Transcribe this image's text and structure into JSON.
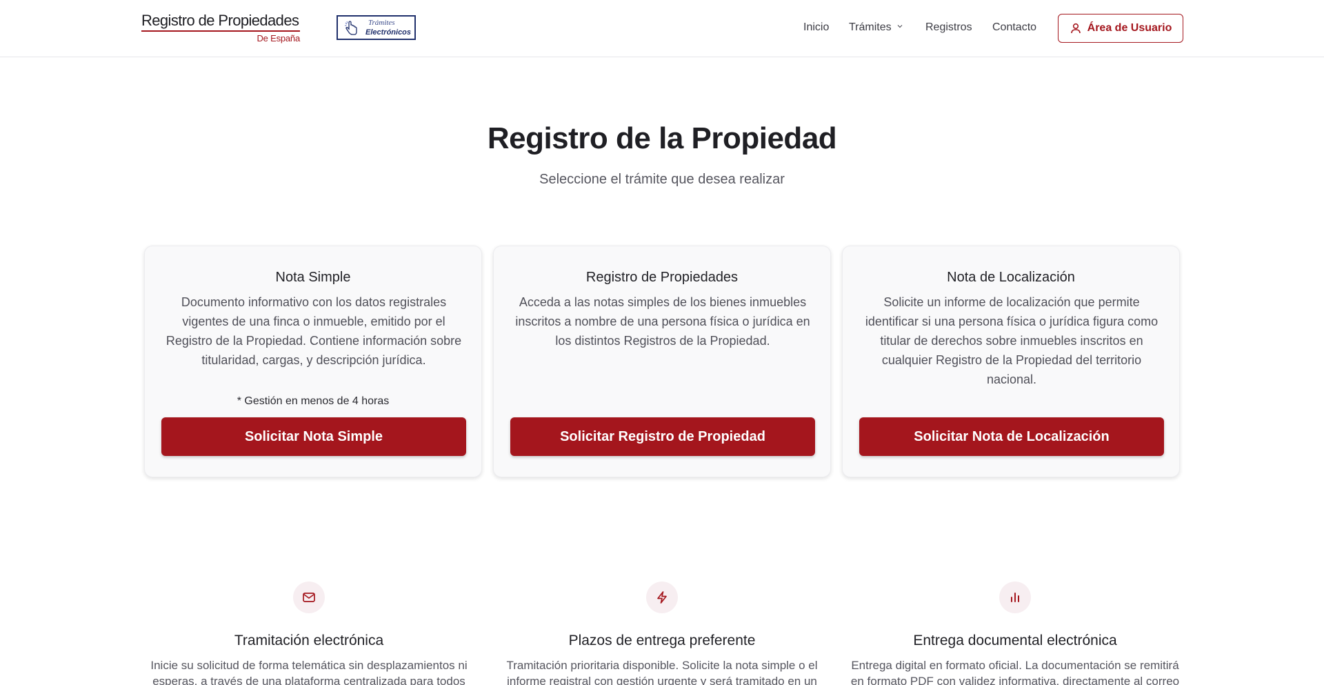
{
  "header": {
    "logo_main": "Registro de Propiedades",
    "logo_sub": "De España",
    "tramites_line1": "Trámites",
    "tramites_line2": "Electrónicos",
    "nav": {
      "inicio": "Inicio",
      "tramites": "Trámites",
      "registros": "Registros",
      "contacto": "Contacto"
    },
    "user_button": "Área de Usuario"
  },
  "hero": {
    "title": "Registro de la Propiedad",
    "subtitle": "Seleccione el trámite que desea realizar"
  },
  "cards": [
    {
      "title": "Nota Simple",
      "description": "Documento informativo con los datos registrales vigentes de una finca o inmueble, emitido por el Registro de la Propiedad. Contiene información sobre titularidad, cargas, y descripción jurídica.",
      "note": "* Gestión en menos de 4 horas",
      "button": "Solicitar Nota Simple"
    },
    {
      "title": "Registro de Propiedades",
      "description": "Acceda a las notas simples de los bienes inmuebles inscritos a nombre de una persona física o jurídica en los distintos Registros de la Propiedad.",
      "note": "",
      "button": "Solicitar Registro de Propiedad"
    },
    {
      "title": "Nota de Localización",
      "description": "Solicite un informe de localización que permite identificar si una persona física o jurídica figura como titular de derechos sobre inmuebles inscritos en cualquier Registro de la Propiedad del territorio nacional.",
      "note": "",
      "button": "Solicitar Nota de Localización"
    }
  ],
  "features": [
    {
      "icon": "mail-icon",
      "title": "Tramitación electrónica",
      "description": "Inicie su solicitud de forma telemática sin desplazamientos ni esperas, a través de una plataforma centralizada para todos"
    },
    {
      "icon": "lightning-icon",
      "title": "Plazos de entrega preferente",
      "description": "Tramitación prioritaria disponible. Solicite la nota simple o el informe registral con gestión urgente y será tramitado en un"
    },
    {
      "icon": "bar-chart-icon",
      "title": "Entrega documental electrónica",
      "description": "Entrega digital en formato oficial. La documentación se remitirá en formato PDF con validez informativa, directamente al correo"
    }
  ],
  "colors": {
    "brand": "#a4161d",
    "text": "#1f1f24",
    "muted": "#55555e",
    "card_bg": "#f9f9fa",
    "icon_bg": "#f7eef1"
  }
}
